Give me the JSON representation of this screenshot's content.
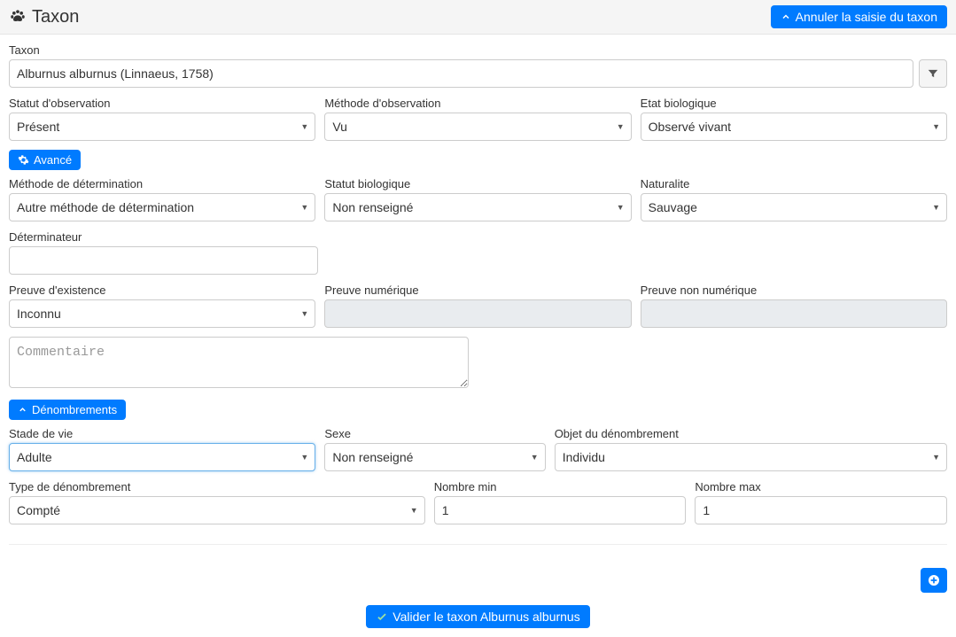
{
  "header": {
    "title": "Taxon",
    "cancel_label": "Annuler la saisie du taxon"
  },
  "taxon": {
    "label": "Taxon",
    "value": "Alburnus alburnus (Linnaeus, 1758)"
  },
  "obs_status": {
    "label": "Statut d'observation",
    "value": "Présent"
  },
  "obs_method": {
    "label": "Méthode d'observation",
    "value": "Vu"
  },
  "bio_state": {
    "label": "Etat biologique",
    "value": "Observé vivant"
  },
  "advanced_label": "Avancé",
  "det_method": {
    "label": "Méthode de détermination",
    "value": "Autre méthode de détermination"
  },
  "bio_status": {
    "label": "Statut biologique",
    "value": "Non renseigné"
  },
  "naturalite": {
    "label": "Naturalite",
    "value": "Sauvage"
  },
  "determinateur": {
    "label": "Déterminateur",
    "value": ""
  },
  "proof_exist": {
    "label": "Preuve d'existence",
    "value": "Inconnu"
  },
  "proof_digital": {
    "label": "Preuve numérique",
    "value": ""
  },
  "proof_nondigital": {
    "label": "Preuve non numérique",
    "value": ""
  },
  "comment_placeholder": "Commentaire",
  "counts_label": "Dénombrements",
  "life_stage": {
    "label": "Stade de vie",
    "value": "Adulte"
  },
  "sex": {
    "label": "Sexe",
    "value": "Non renseigné"
  },
  "count_object": {
    "label": "Objet du dénombrement",
    "value": "Individu"
  },
  "count_type": {
    "label": "Type de dénombrement",
    "value": "Compté"
  },
  "nb_min": {
    "label": "Nombre min",
    "value": "1"
  },
  "nb_max": {
    "label": "Nombre max",
    "value": "1"
  },
  "validate_label": "Valider le taxon Alburnus alburnus"
}
